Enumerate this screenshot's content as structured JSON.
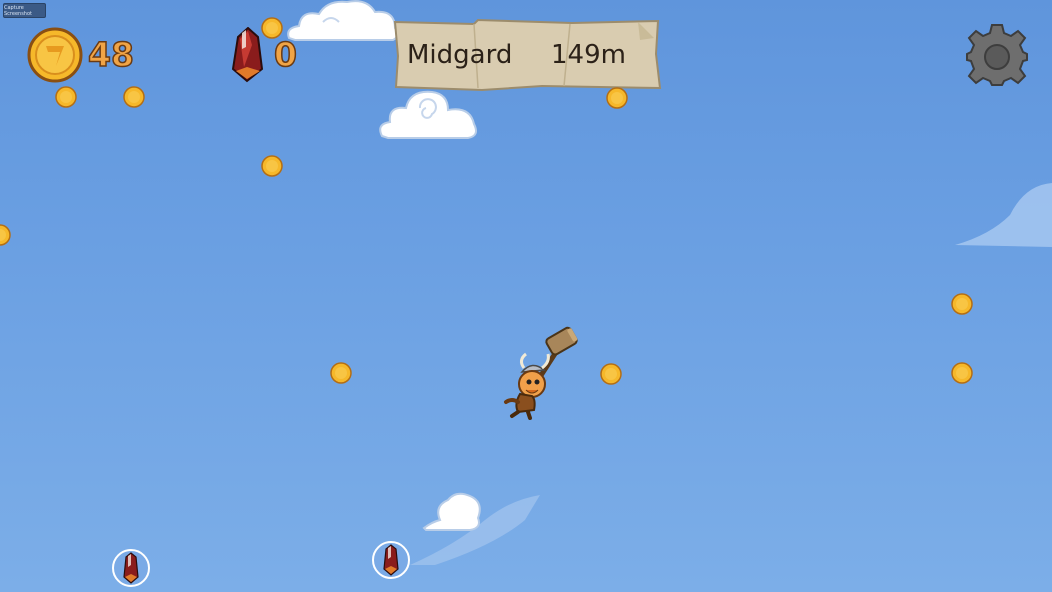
{
  "hud": {
    "coin_count": "48",
    "gem_count": "0",
    "debug_button_label": "Capture Screenshot",
    "settings_icon": "gear-icon"
  },
  "location_sign": {
    "realm": "Midgard",
    "distance": "149m"
  },
  "colors": {
    "sky_top": "#5f95dc",
    "sky_bottom": "#7caee8",
    "coin_gold": "#f6b82a",
    "hud_number": "#f0a446",
    "sign_parchment": "#d9ccb0"
  },
  "icons": [
    "coin-icon",
    "gem-icon",
    "gear-icon",
    "viking-hammer-player",
    "cloud",
    "gem-bubble"
  ]
}
